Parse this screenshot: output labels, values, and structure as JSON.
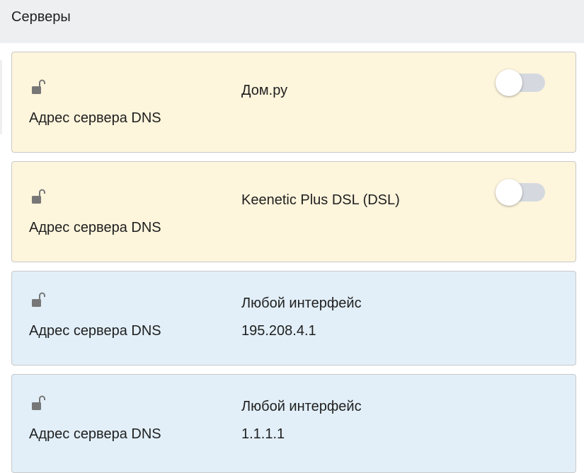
{
  "header": {
    "title": "Серверы"
  },
  "servers": [
    {
      "field_label": "Адрес сервера DNS",
      "interface": "Дом.ру",
      "value": "",
      "enabled": false
    },
    {
      "field_label": "Адрес сервера DNS",
      "interface": "Keenetic Plus DSL (DSL)",
      "value": "",
      "enabled": false
    },
    {
      "field_label": "Адрес сервера DNS",
      "interface": "Любой интерфейс",
      "value": "195.208.4.1"
    },
    {
      "field_label": "Адрес сервера DNS",
      "interface": "Любой интерфейс",
      "value": "1.1.1.1"
    }
  ],
  "colors": {
    "header_bg": "#eeeff0",
    "card_provider_bg": "#fdf5dc",
    "card_static_bg": "#e2eff8",
    "toggle_off_track": "#d5d9df"
  },
  "icons": {
    "lock": "unlocked-padlock-icon"
  }
}
